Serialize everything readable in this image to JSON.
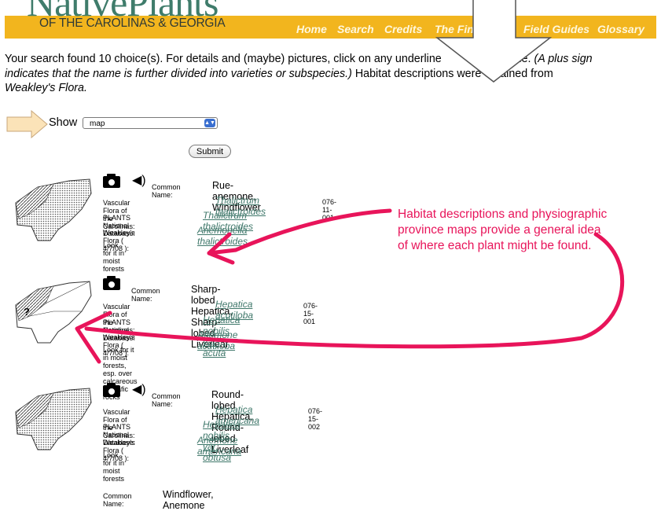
{
  "header": {
    "logo_text": "NativePlants",
    "subtitle": "OF THE CAROLINAS & GEORGIA",
    "nav": [
      "Home",
      "Search",
      "Credits",
      "The Fin",
      "Field Guides",
      "Glossary"
    ]
  },
  "intro": {
    "line1": "Your search found 10 choice(s). For details and (maybe) pictures, click on any underline",
    "line1_end": "name.",
    "line1_italic": "(A plus sign",
    "line2_italic": "indicates that the name is further divided into varieties or subspecies.)",
    "line2_rest": "Habitat descriptions were obtained from",
    "line3_italic": "Weakley's Flora."
  },
  "controls": {
    "show_label": "Show",
    "select_value": "map",
    "submit_label": "Submit"
  },
  "labels": {
    "common_name": "Common Name:",
    "vascular": "Vascular Flora of the Carolinas:",
    "plants": "PLANTS National Database:",
    "weakley": "Weakley's Flora ( 4/7/08 ):"
  },
  "entries": [
    {
      "common_name": "Rue-anemone, Windflower",
      "vascular_name": "Thalictrum thalictroides",
      "vascular_code": "076-11-001",
      "plants_name": "Thalictrum thalictroides",
      "weakley_name": "Anemonella thalictroides",
      "habitat": "Look for it in moist forests",
      "has_audio": true
    },
    {
      "common_name": "Sharp-lobed Hepatica, Sharp-lobed Liverleaf",
      "vascular_name": "Hepatica acutiloba",
      "vascular_code": "076-15-001",
      "plants_name": "Hepatica nobilis var. acuta",
      "weakley_name": "Anemone acutiloba",
      "habitat": "Look for it in moist forests, esp. over calcareous or mafic rocks",
      "has_audio": false,
      "map_mark": "?"
    },
    {
      "common_name": "Round-lobed Hepatica, Round-lobed Liverleaf",
      "vascular_name": "Hepatica americana",
      "vascular_code": "076-15-002",
      "plants_name": "Hepatica nobilis var. obtusa",
      "weakley_name": "Anemone americana",
      "habitat": "Look for it in moist forests",
      "has_audio": true
    },
    {
      "common_name": "Windflower, Anemone"
    }
  ],
  "annotation": {
    "text": "Habitat descriptions and physiographic province maps provide a general idea of where each plant might be found.",
    "color": "#e8145a"
  },
  "colors": {
    "banner": "#f2b51e",
    "link": "#40786b",
    "logo": "#3f7c6b"
  }
}
